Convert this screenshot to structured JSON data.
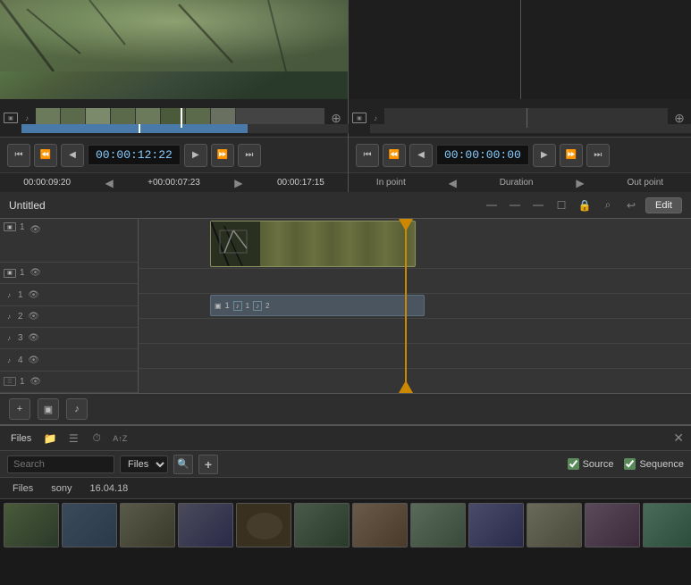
{
  "preview_left": {
    "timecode": "00:00:12:22",
    "time_in": "00:00:09:20",
    "time_offset": "+00:00:07:23",
    "time_out": "00:00:17:15"
  },
  "preview_right": {
    "timecode": "00:00:00:00",
    "in_point_label": "In point",
    "duration_label": "Duration",
    "out_point_label": "Out point"
  },
  "timeline": {
    "title": "Untitled",
    "edit_label": "Edit",
    "tracks": [
      {
        "type": "video",
        "num": "1",
        "monitor": true
      },
      {
        "type": "video",
        "num": "1",
        "monitor": true
      },
      {
        "type": "audio",
        "num": "1"
      },
      {
        "type": "audio",
        "num": "2"
      },
      {
        "type": "audio",
        "num": "3"
      },
      {
        "type": "audio",
        "num": "4"
      },
      {
        "type": "subtitle",
        "num": "1"
      }
    ]
  },
  "files": {
    "tab_label": "Files",
    "search_placeholder": "Search",
    "dropdown_value": "Files",
    "source_label": "Source",
    "sequence_label": "Sequence",
    "breadcrumb": [
      "Files",
      "sony",
      "16.04.18"
    ]
  },
  "icons": {
    "monitor": "▣",
    "speaker": "♪",
    "eye": "👁",
    "zoom_in": "⊕",
    "zoom_out": "⊖",
    "play": "▶",
    "pause": "⏸",
    "stop": "■",
    "prev": "⏮",
    "next": "⏭",
    "step_back": "⏪",
    "step_fwd": "⏩",
    "arrow_left": "◀",
    "arrow_right": "▶",
    "search": "🔍",
    "add": "+",
    "close": "✕",
    "folder": "📁",
    "list": "☰",
    "clock": "⏱",
    "sort": "AZ",
    "scissors": "✂",
    "link": "🔗",
    "lock": "🔒",
    "undo": "↩",
    "magnet": "⊞",
    "filmstrip": "🎞"
  }
}
